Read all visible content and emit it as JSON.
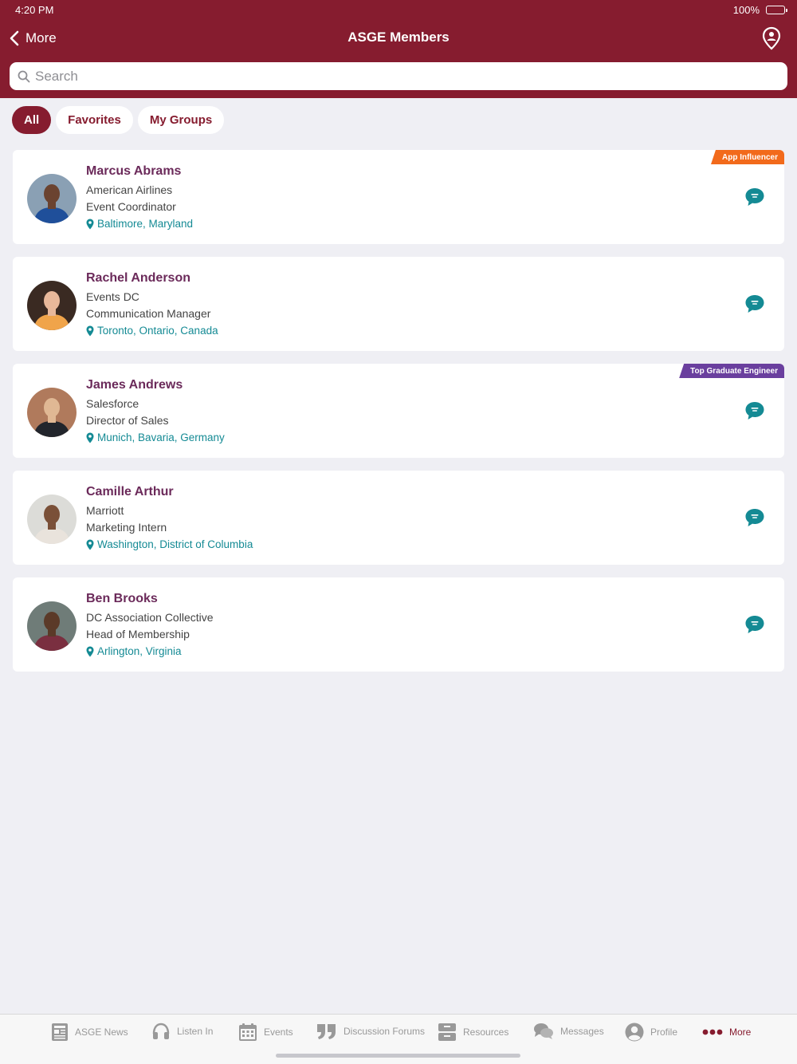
{
  "status": {
    "time": "4:20 PM",
    "battery": "100%"
  },
  "nav": {
    "back_label": "More",
    "title": "ASGE Members"
  },
  "search": {
    "placeholder": "Search"
  },
  "filters": [
    {
      "label": "All",
      "active": true
    },
    {
      "label": "Favorites",
      "active": false
    },
    {
      "label": "My Groups",
      "active": false
    }
  ],
  "members": [
    {
      "name": "Marcus Abrams",
      "company": "American Airlines",
      "title": "Event Coordinator",
      "location": "Baltimore, Maryland",
      "badge": "App Influencer",
      "badge_color": "#f26a1b",
      "avatar_bg": "#8aa0b4",
      "skin": "#6b4330",
      "shirt": "#1f4f9a"
    },
    {
      "name": "Rachel Anderson",
      "company": "Events DC",
      "title": "Communication Manager",
      "location": "Toronto, Ontario, Canada",
      "badge": "",
      "badge_color": "",
      "avatar_bg": "#3a2a22",
      "skin": "#e8b89a",
      "shirt": "#f0a44a"
    },
    {
      "name": "James Andrews",
      "company": "Salesforce",
      "title": "Director of Sales",
      "location": "Munich, Bavaria, Germany",
      "badge": "Top Graduate Engineer",
      "badge_color": "#6a3f9e",
      "avatar_bg": "#b07a5c",
      "skin": "#e0b894",
      "shirt": "#22252c"
    },
    {
      "name": "Camille Arthur",
      "company": "Marriott",
      "title": "Marketing Intern",
      "location": "Washington, District of Columbia",
      "badge": "",
      "badge_color": "",
      "avatar_bg": "#dcdcd8",
      "skin": "#7a5038",
      "shirt": "#e9e3dc"
    },
    {
      "name": "Ben Brooks",
      "company": "DC Association Collective",
      "title": "Head of Membership",
      "location": "Arlington, Virginia",
      "badge": "",
      "badge_color": "",
      "avatar_bg": "#6f7c78",
      "skin": "#5b3a28",
      "shirt": "#7a2f40"
    }
  ],
  "tabs": [
    {
      "label": "ASGE News",
      "icon": "news-icon",
      "active": false
    },
    {
      "label": "Listen In",
      "icon": "headphones-icon",
      "active": false
    },
    {
      "label": "Events",
      "icon": "calendar-icon",
      "active": false
    },
    {
      "label": "Discussion Forums",
      "icon": "quote-icon",
      "active": false
    },
    {
      "label": "Resources",
      "icon": "archive-box-icon",
      "active": false
    },
    {
      "label": "Messages",
      "icon": "chat-bubbles-icon",
      "active": false
    },
    {
      "label": "Profile",
      "icon": "user-circle-icon",
      "active": false
    },
    {
      "label": "More",
      "icon": "more-dots-icon",
      "active": true
    }
  ],
  "colors": {
    "brand": "#861c2f",
    "accent": "#148a94",
    "name": "#6b2a5a"
  }
}
